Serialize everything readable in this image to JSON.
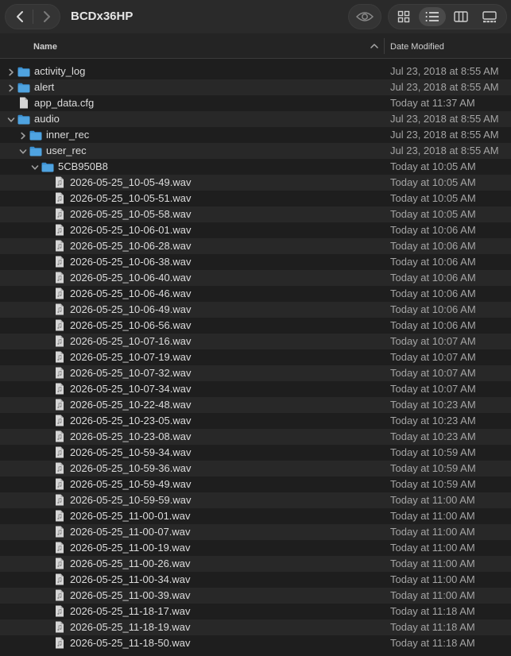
{
  "window": {
    "title": "BCDx36HP"
  },
  "toolbar": {
    "back_icon": "chevron-left-icon",
    "forward_icon": "chevron-right-icon",
    "quicklook_icon": "eye-icon",
    "views": [
      {
        "name": "view-icons",
        "icon": "grid-icon",
        "active": false
      },
      {
        "name": "view-list",
        "icon": "list-icon",
        "active": true
      },
      {
        "name": "view-columns",
        "icon": "columns-icon",
        "active": false
      },
      {
        "name": "view-gallery",
        "icon": "gallery-icon",
        "active": false
      }
    ]
  },
  "columns": {
    "name": "Name",
    "date_modified": "Date Modified"
  },
  "colors": {
    "folder": "#4fa3e0",
    "folder_tab": "#3b8fd0",
    "file": "#d6d6d6"
  },
  "rows": [
    {
      "name": "activity_log",
      "date": "Jul 23, 2018 at 8:55 AM",
      "type": "folder",
      "depth": 0,
      "disclosure": "collapsed"
    },
    {
      "name": "alert",
      "date": "Jul 23, 2018 at 8:55 AM",
      "type": "folder",
      "depth": 0,
      "disclosure": "collapsed"
    },
    {
      "name": "app_data.cfg",
      "date": "Today at 11:37 AM",
      "type": "doc",
      "depth": 0,
      "disclosure": "none"
    },
    {
      "name": "audio",
      "date": "Jul 23, 2018 at 8:55 AM",
      "type": "folder",
      "depth": 0,
      "disclosure": "expanded"
    },
    {
      "name": "inner_rec",
      "date": "Jul 23, 2018 at 8:55 AM",
      "type": "folder",
      "depth": 1,
      "disclosure": "collapsed"
    },
    {
      "name": "user_rec",
      "date": "Jul 23, 2018 at 8:55 AM",
      "type": "folder",
      "depth": 1,
      "disclosure": "expanded"
    },
    {
      "name": "5CB950B8",
      "date": "Today at 10:05 AM",
      "type": "folder",
      "depth": 2,
      "disclosure": "expanded"
    },
    {
      "name": "2026-05-25_10-05-49.wav",
      "date": "Today at 10:05 AM",
      "type": "audio",
      "depth": 3,
      "disclosure": "none"
    },
    {
      "name": "2026-05-25_10-05-51.wav",
      "date": "Today at 10:05 AM",
      "type": "audio",
      "depth": 3,
      "disclosure": "none"
    },
    {
      "name": "2026-05-25_10-05-58.wav",
      "date": "Today at 10:05 AM",
      "type": "audio",
      "depth": 3,
      "disclosure": "none"
    },
    {
      "name": "2026-05-25_10-06-01.wav",
      "date": "Today at 10:06 AM",
      "type": "audio",
      "depth": 3,
      "disclosure": "none"
    },
    {
      "name": "2026-05-25_10-06-28.wav",
      "date": "Today at 10:06 AM",
      "type": "audio",
      "depth": 3,
      "disclosure": "none"
    },
    {
      "name": "2026-05-25_10-06-38.wav",
      "date": "Today at 10:06 AM",
      "type": "audio",
      "depth": 3,
      "disclosure": "none"
    },
    {
      "name": "2026-05-25_10-06-40.wav",
      "date": "Today at 10:06 AM",
      "type": "audio",
      "depth": 3,
      "disclosure": "none"
    },
    {
      "name": "2026-05-25_10-06-46.wav",
      "date": "Today at 10:06 AM",
      "type": "audio",
      "depth": 3,
      "disclosure": "none"
    },
    {
      "name": "2026-05-25_10-06-49.wav",
      "date": "Today at 10:06 AM",
      "type": "audio",
      "depth": 3,
      "disclosure": "none"
    },
    {
      "name": "2026-05-25_10-06-56.wav",
      "date": "Today at 10:06 AM",
      "type": "audio",
      "depth": 3,
      "disclosure": "none"
    },
    {
      "name": "2026-05-25_10-07-16.wav",
      "date": "Today at 10:07 AM",
      "type": "audio",
      "depth": 3,
      "disclosure": "none"
    },
    {
      "name": "2026-05-25_10-07-19.wav",
      "date": "Today at 10:07 AM",
      "type": "audio",
      "depth": 3,
      "disclosure": "none"
    },
    {
      "name": "2026-05-25_10-07-32.wav",
      "date": "Today at 10:07 AM",
      "type": "audio",
      "depth": 3,
      "disclosure": "none"
    },
    {
      "name": "2026-05-25_10-07-34.wav",
      "date": "Today at 10:07 AM",
      "type": "audio",
      "depth": 3,
      "disclosure": "none"
    },
    {
      "name": "2026-05-25_10-22-48.wav",
      "date": "Today at 10:23 AM",
      "type": "audio",
      "depth": 3,
      "disclosure": "none"
    },
    {
      "name": "2026-05-25_10-23-05.wav",
      "date": "Today at 10:23 AM",
      "type": "audio",
      "depth": 3,
      "disclosure": "none"
    },
    {
      "name": "2026-05-25_10-23-08.wav",
      "date": "Today at 10:23 AM",
      "type": "audio",
      "depth": 3,
      "disclosure": "none"
    },
    {
      "name": "2026-05-25_10-59-34.wav",
      "date": "Today at 10:59 AM",
      "type": "audio",
      "depth": 3,
      "disclosure": "none"
    },
    {
      "name": "2026-05-25_10-59-36.wav",
      "date": "Today at 10:59 AM",
      "type": "audio",
      "depth": 3,
      "disclosure": "none"
    },
    {
      "name": "2026-05-25_10-59-49.wav",
      "date": "Today at 10:59 AM",
      "type": "audio",
      "depth": 3,
      "disclosure": "none"
    },
    {
      "name": "2026-05-25_10-59-59.wav",
      "date": "Today at 11:00 AM",
      "type": "audio",
      "depth": 3,
      "disclosure": "none"
    },
    {
      "name": "2026-05-25_11-00-01.wav",
      "date": "Today at 11:00 AM",
      "type": "audio",
      "depth": 3,
      "disclosure": "none"
    },
    {
      "name": "2026-05-25_11-00-07.wav",
      "date": "Today at 11:00 AM",
      "type": "audio",
      "depth": 3,
      "disclosure": "none"
    },
    {
      "name": "2026-05-25_11-00-19.wav",
      "date": "Today at 11:00 AM",
      "type": "audio",
      "depth": 3,
      "disclosure": "none"
    },
    {
      "name": "2026-05-25_11-00-26.wav",
      "date": "Today at 11:00 AM",
      "type": "audio",
      "depth": 3,
      "disclosure": "none"
    },
    {
      "name": "2026-05-25_11-00-34.wav",
      "date": "Today at 11:00 AM",
      "type": "audio",
      "depth": 3,
      "disclosure": "none"
    },
    {
      "name": "2026-05-25_11-00-39.wav",
      "date": "Today at 11:00 AM",
      "type": "audio",
      "depth": 3,
      "disclosure": "none"
    },
    {
      "name": "2026-05-25_11-18-17.wav",
      "date": "Today at 11:18 AM",
      "type": "audio",
      "depth": 3,
      "disclosure": "none"
    },
    {
      "name": "2026-05-25_11-18-19.wav",
      "date": "Today at 11:18 AM",
      "type": "audio",
      "depth": 3,
      "disclosure": "none"
    },
    {
      "name": "2026-05-25_11-18-50.wav",
      "date": "Today at 11:18 AM",
      "type": "audio",
      "depth": 3,
      "disclosure": "none"
    }
  ]
}
